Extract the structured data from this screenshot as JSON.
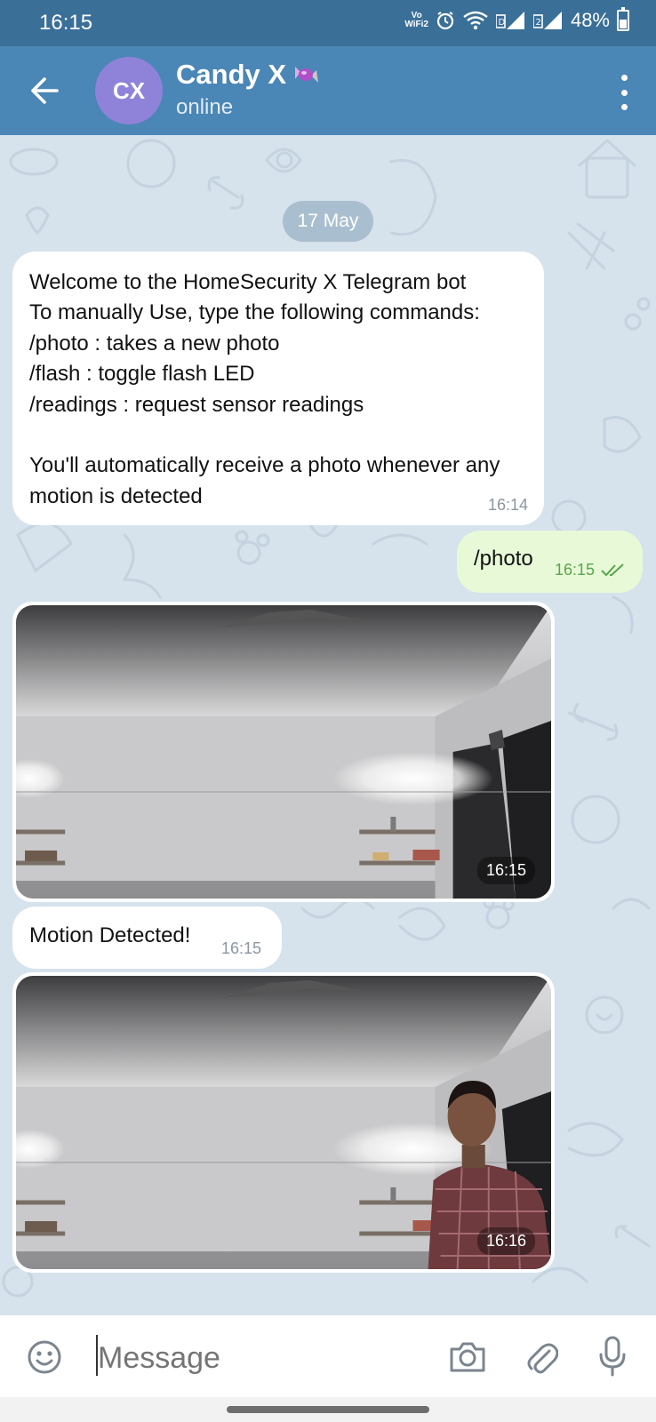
{
  "status_bar": {
    "time": "16:15",
    "vowifi_top": "Vo",
    "vowifi_bottom": "WiFi2",
    "battery": "48%",
    "battery_level": 0.48
  },
  "header": {
    "avatar_initials": "CX",
    "title": "Candy X",
    "subtitle": "online",
    "accent_color": "#4a86b6",
    "avatar_color": "#8f83d9"
  },
  "chat": {
    "date_divider": "17 May",
    "messages": [
      {
        "type": "text",
        "direction": "incoming",
        "text": "Welcome to the HomeSecurity X Telegram bot\nTo manually Use, type the following commands:\n/photo : takes a new photo\n/flash : toggle flash LED\n/readings : request sensor readings\n\nYou'll automatically receive a photo whenever any motion is detected",
        "time": "16:14"
      },
      {
        "type": "text",
        "direction": "outgoing",
        "text": "/photo",
        "time": "16:15",
        "status": "read"
      },
      {
        "type": "photo",
        "direction": "incoming",
        "time": "16:15"
      },
      {
        "type": "text",
        "direction": "incoming",
        "text": "Motion Detected!",
        "time": "16:15"
      },
      {
        "type": "photo",
        "direction": "incoming",
        "time": "16:16"
      }
    ]
  },
  "input": {
    "placeholder": "Message",
    "icons": [
      "emoji-icon",
      "camera-icon",
      "attach-icon",
      "microphone-icon"
    ]
  }
}
